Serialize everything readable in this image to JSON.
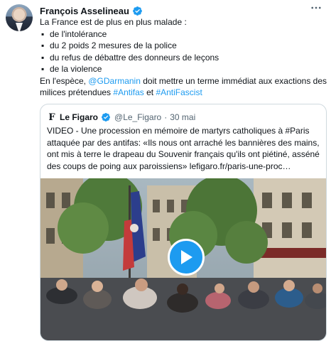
{
  "author": {
    "name": "François Asselineau",
    "verified": true,
    "more_icon": "more-horizontal-icon"
  },
  "tweet": {
    "intro": "La France est de plus en plus malade :",
    "bullets": [
      "de l'intolérance",
      "du 2 poids 2 mesures de la police",
      "du refus de débattre des donneurs de leçons",
      "de la violence"
    ],
    "line_start": "En l'espèce, ",
    "mention": "@GDarmanin",
    "line_mid": " doit mettre un terme immédiat aux  exactions des milices prétendues ",
    "hashtag1": "#Antifas",
    "line_and": " et ",
    "hashtag2": "#AntiFascist"
  },
  "quote": {
    "logo": "F",
    "name": "Le Figaro",
    "handle": "@Le_Figaro",
    "dot": "·",
    "date": "30 mai",
    "text": "VIDEO - Une procession en mémoire de martyrs catholiques à #Paris attaquée par des antifas: «Ils nous ont arraché les bannières des mains, ont mis à terre le drapeau du Souvenir français qu'ils ont piétiné, asséné des coups de poing aux paroissiens» lefigaro.fr/paris-une-proc…",
    "media_icon": "play-icon"
  },
  "colors": {
    "accent": "#1d9bf0",
    "text": "#0f1419",
    "muted": "#536471",
    "border": "#cfd9de"
  }
}
